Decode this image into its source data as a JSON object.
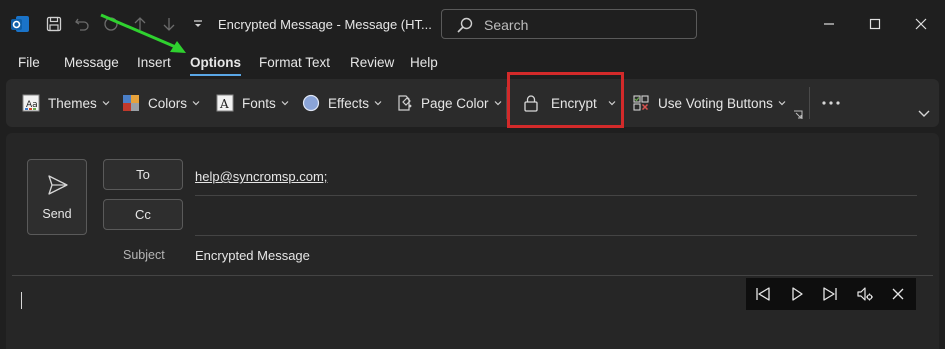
{
  "window": {
    "title": "Encrypted Message  -  Message (HT...",
    "search_placeholder": "Search"
  },
  "tabs": [
    {
      "label": "File"
    },
    {
      "label": "Message"
    },
    {
      "label": "Insert"
    },
    {
      "label": "Options",
      "active": true
    },
    {
      "label": "Format Text"
    },
    {
      "label": "Review"
    },
    {
      "label": "Help"
    }
  ],
  "ribbon": {
    "themes": "Themes",
    "colors": "Colors",
    "fonts": "Fonts",
    "effects": "Effects",
    "page_color": "Page Color",
    "encrypt": "Encrypt",
    "voting": "Use Voting Buttons"
  },
  "compose": {
    "send_label": "Send",
    "to_label": "To",
    "cc_label": "Cc",
    "to_value": "help@syncromsp.com;",
    "subject_label": "Subject",
    "subject_value": "Encrypted Message"
  },
  "colors": {
    "accent": "#5aa7e6",
    "highlight": "#d32a2a",
    "arrow": "#2fd12f"
  }
}
